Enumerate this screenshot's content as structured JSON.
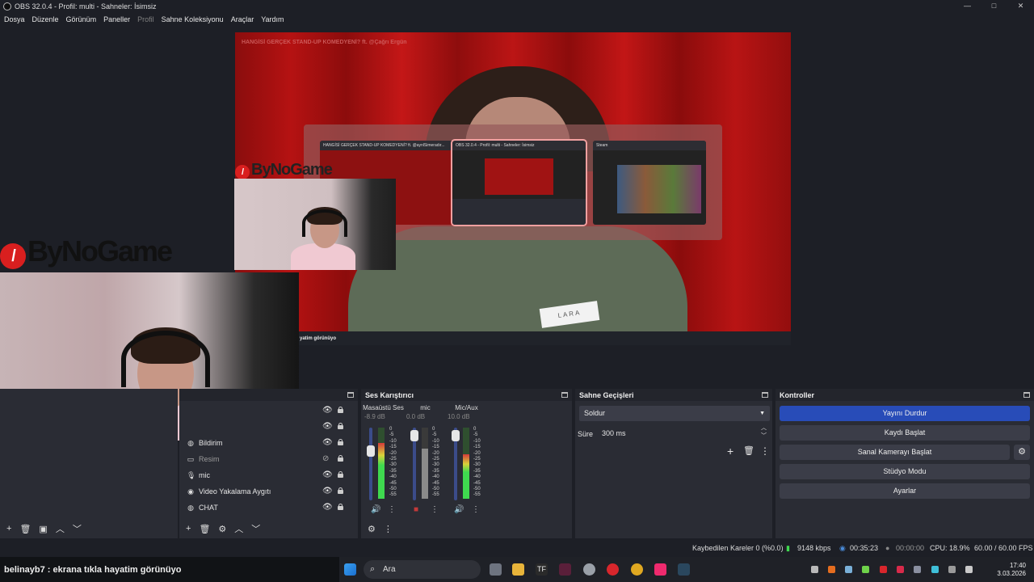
{
  "window": {
    "title": "OBS 32.0.4 - Profil: multi - Sahneler: İsimsiz",
    "minimize": "—",
    "maximize": "□",
    "close": "✕"
  },
  "menu": {
    "items": [
      "Dosya",
      "Düzenle",
      "Görünüm",
      "Paneller",
      "Profil",
      "Sahne Koleksiyonu",
      "Araçlar",
      "Yardım"
    ],
    "disabled": [
      "Profil"
    ]
  },
  "preview": {
    "overlay_text": "HANGİSİ GERÇEK STAND-UP KOMEDYENİ? ft. @Çağrı Ergün",
    "nametag": "LARA",
    "taskbar_text": "yatim görünüyo",
    "logo_small": "ByNoGame",
    "logo_large": "ByNoGame",
    "switcher": {
      "items": [
        {
          "title": "HANGİSİ GERÇEK STAND-UP KOMEDYENİ? ft. @aynlSimeradır..."
        },
        {
          "title": "OBS 32.0.4 - Profil: multi - Sahneler: İsimsiz"
        },
        {
          "title": "Steam"
        }
      ],
      "active_index": 1
    }
  },
  "sources": {
    "items": [
      {
        "label": "Bildirim",
        "icon": "globe-icon",
        "visible": true
      },
      {
        "label": "Resim",
        "icon": "image-icon",
        "visible": false
      },
      {
        "label": "mic",
        "icon": "microphone-icon",
        "visible": true
      },
      {
        "label": "Video Yakalama Aygıtı",
        "icon": "camera-icon",
        "visible": true
      },
      {
        "label": "CHAT",
        "icon": "globe-icon",
        "visible": true
      }
    ]
  },
  "mixer": {
    "title": "Ses Karıştırıcı",
    "channels": [
      {
        "name": "Masaüstü Ses",
        "db": "-8.9 dB",
        "level": 0.78,
        "fader": 0.75,
        "muted": false
      },
      {
        "name": "mic",
        "db": "0.0 dB",
        "level": 0.7,
        "fader": 0.9,
        "muted": true
      },
      {
        "name": "Mic/Aux",
        "db": "10.0 dB",
        "level": 0.62,
        "fader": 0.9,
        "muted": false
      }
    ],
    "scale": [
      "0",
      "-5",
      "-10",
      "-15",
      "-20",
      "-25",
      "-30",
      "-35",
      "-40",
      "-45",
      "-50",
      "-55",
      "-60"
    ]
  },
  "transitions": {
    "title": "Sahne Geçişleri",
    "selected": "Soldur",
    "duration_label": "Süre",
    "duration_value": "300 ms"
  },
  "controls": {
    "title": "Kontroller",
    "buttons": [
      "Yayını Durdur",
      "Kaydı Başlat",
      "Sanal Kamerayı Başlat",
      "Stüdyo Modu",
      "Ayarlar"
    ]
  },
  "status": {
    "dropped": "Kaybedilen Kareler 0 (%0.0)",
    "bitrate": "9148 kbps",
    "stream_time": "00:35:23",
    "rec_time": "00:00:00",
    "cpu": "CPU: 18.9%",
    "fps": "60.00 / 60.00 FPS"
  },
  "chat": {
    "message": "belinayb7 : ekrana tıkla hayatim görünüyo"
  },
  "taskbar": {
    "search_placeholder": "Ara",
    "time": "17:40",
    "date": "3.03.2026"
  },
  "colors": {
    "accent": "#284cb8",
    "panel": "#2a2c34",
    "background": "#1d1f26",
    "meter_green": "#3fd94f",
    "meter_yellow": "#d8d23a",
    "meter_red": "#d43a3a"
  }
}
